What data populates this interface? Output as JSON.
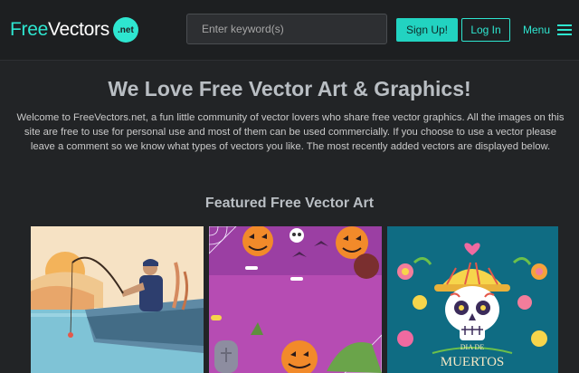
{
  "header": {
    "logo_part1": "Free",
    "logo_part2": "Vectors",
    "logo_badge": ".net",
    "search_placeholder": "Enter keyword(s)",
    "signup_label": "Sign Up!",
    "login_label": "Log In",
    "menu_label": "Menu"
  },
  "hero": {
    "title": "We Love Free Vector Art & Graphics!",
    "description": "Welcome to FreeVectors.net, a fun little community of vector lovers who share free vector graphics. All the images on this site are free to use for personal use and most of them can be used commercially. If you choose to use a vector please leave a comment so we know what types of vectors you like. The most recently added vectors are displayed below."
  },
  "featured": {
    "title": "Featured Free Vector Art",
    "cards": [
      {
        "subject": "fisherman-in-boat"
      },
      {
        "subject": "halloween-pumpkins"
      },
      {
        "subject": "dia-de-muertos-skull",
        "text_line1": "DIA DE",
        "text_line2": "MUERTOS"
      }
    ]
  },
  "colors": {
    "accent": "#2ee6d0",
    "background": "#222426",
    "header_bg": "#1d1f21"
  }
}
